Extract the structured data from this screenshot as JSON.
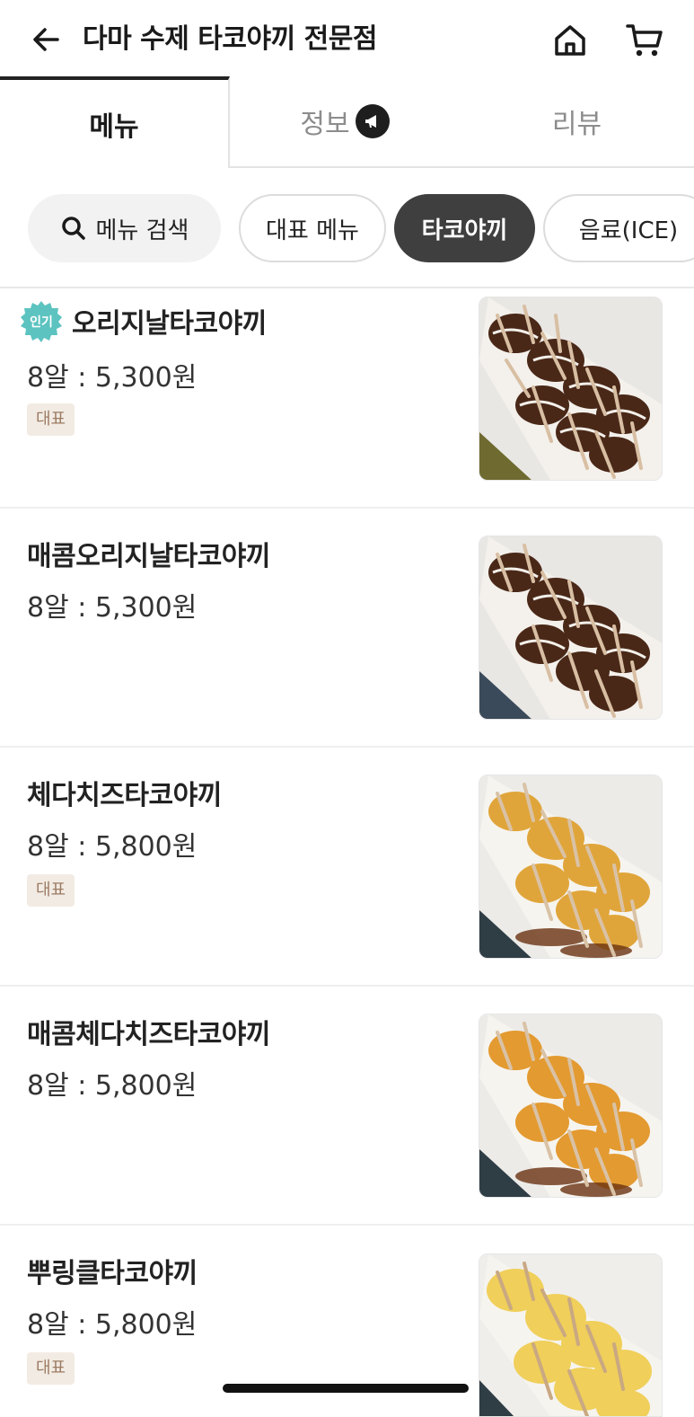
{
  "header": {
    "title": "다마 수제 타코야끼 전문점",
    "icons": {
      "back": "arrow-left-icon",
      "home": "home-icon",
      "cart": "cart-icon"
    }
  },
  "tabs": [
    {
      "label": "메뉴",
      "active": true
    },
    {
      "label": "정보",
      "active": false,
      "badge_icon": "megaphone-icon"
    },
    {
      "label": "리뷰",
      "active": false
    }
  ],
  "chips": {
    "search": {
      "label": "메뉴 검색",
      "icon": "search-icon"
    },
    "items": [
      {
        "label": "대표 메뉴",
        "active": false
      },
      {
        "label": "타코야끼",
        "active": true
      },
      {
        "label": "음료(ICE)",
        "active": false
      }
    ]
  },
  "menu_items": [
    {
      "name": "오리지날타코야끼",
      "price": "8알 : 5,300원",
      "tag": "대표",
      "popular_label": "인기"
    },
    {
      "name": "매콤오리지날타코야끼",
      "price": "8알 : 5,300원",
      "tag": ""
    },
    {
      "name": "체다치즈타코야끼",
      "price": "8알 : 5,800원",
      "tag": "대표"
    },
    {
      "name": "매콤체다치즈타코야끼",
      "price": "8알 : 5,800원",
      "tag": ""
    },
    {
      "name": "뿌링클타코야끼",
      "price": "8알 : 5,800원",
      "tag": "대표"
    }
  ],
  "colors": {
    "accent_dark": "#3f3f3f",
    "popular_badge": "#5cc3c0",
    "tag_bg": "#f2ebe4",
    "tag_text": "#9c7b62"
  }
}
